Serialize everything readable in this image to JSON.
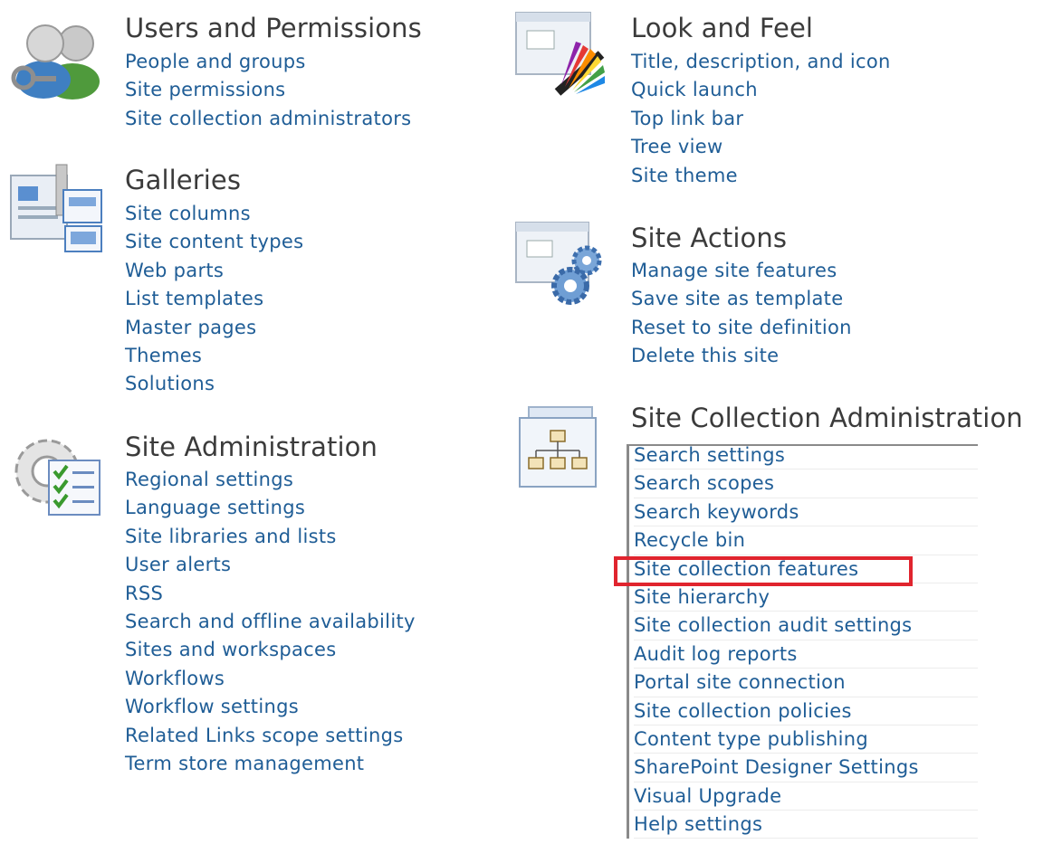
{
  "sections": {
    "users_permissions": {
      "title": "Users and Permissions",
      "links": [
        "People and groups",
        "Site permissions",
        "Site collection administrators"
      ]
    },
    "galleries": {
      "title": "Galleries",
      "links": [
        "Site columns",
        "Site content types",
        "Web parts",
        "List templates",
        "Master pages",
        "Themes",
        "Solutions"
      ]
    },
    "site_administration": {
      "title": "Site Administration",
      "links": [
        "Regional settings",
        "Language settings",
        "Site libraries and lists",
        "User alerts",
        "RSS",
        "Search and offline availability",
        "Sites and workspaces",
        "Workflows",
        "Workflow settings",
        "Related Links scope settings",
        "Term store management"
      ]
    },
    "look_and_feel": {
      "title": "Look and Feel",
      "links": [
        "Title, description, and icon",
        "Quick launch",
        "Top link bar",
        "Tree view",
        "Site theme"
      ]
    },
    "site_actions": {
      "title": "Site Actions",
      "links": [
        "Manage site features",
        "Save site as template",
        "Reset to site definition",
        "Delete this site"
      ]
    },
    "site_collection_administration": {
      "title": "Site Collection Administration",
      "links": [
        "Search settings",
        "Search scopes",
        "Search keywords",
        "Recycle bin",
        "Site collection features",
        "Site hierarchy",
        "Site collection audit settings",
        "Audit log reports",
        "Portal site connection",
        "Site collection policies",
        "Content type publishing",
        "SharePoint Designer Settings",
        "Visual Upgrade",
        "Help settings"
      ]
    }
  },
  "highlighted_link": "Site collection features",
  "colors": {
    "link": "#1f5d96",
    "heading": "#3b3b3b",
    "highlight": "#e0242e"
  },
  "icons": {
    "users_permissions": "users-icon",
    "galleries": "gallery-icon",
    "site_administration": "gear-checklist-icon",
    "look_and_feel": "color-palette-icon",
    "site_actions": "gears-window-icon",
    "site_collection_administration": "hierarchy-icon"
  }
}
